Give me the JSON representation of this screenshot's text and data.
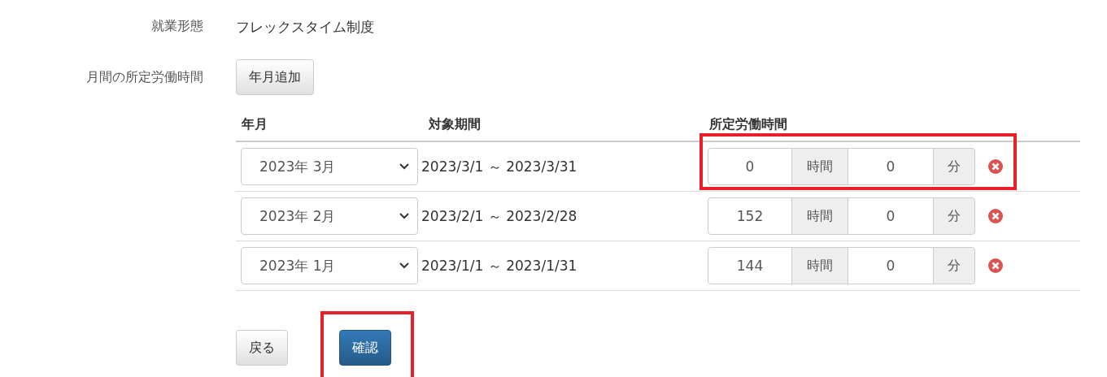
{
  "fields": [
    {
      "label": "就業形態",
      "value": "フレックスタイム制度"
    }
  ],
  "monthly": {
    "label": "月間の所定労働時間",
    "add_button": "年月追加",
    "columns": [
      "年月",
      "対象期間",
      "所定労働時間"
    ],
    "rows": [
      {
        "month": "2023年 3月",
        "period": "2023/3/1 ～ 2023/3/31",
        "hours": "0",
        "hours_unit": "時間",
        "minutes": "0",
        "minutes_unit": "分",
        "highlighted": true
      },
      {
        "month": "2023年 2月",
        "period": "2023/2/1 ～ 2023/2/28",
        "hours": "152",
        "hours_unit": "時間",
        "minutes": "0",
        "minutes_unit": "分",
        "highlighted": false
      },
      {
        "month": "2023年 1月",
        "period": "2023/1/1 ～ 2023/1/31",
        "hours": "144",
        "hours_unit": "時間",
        "minutes": "0",
        "minutes_unit": "分",
        "highlighted": false
      }
    ]
  },
  "buttons": [
    {
      "label": "戻る",
      "kind": "default",
      "highlighted": false
    },
    {
      "label": "確認",
      "kind": "primary",
      "highlighted": true
    }
  ]
}
